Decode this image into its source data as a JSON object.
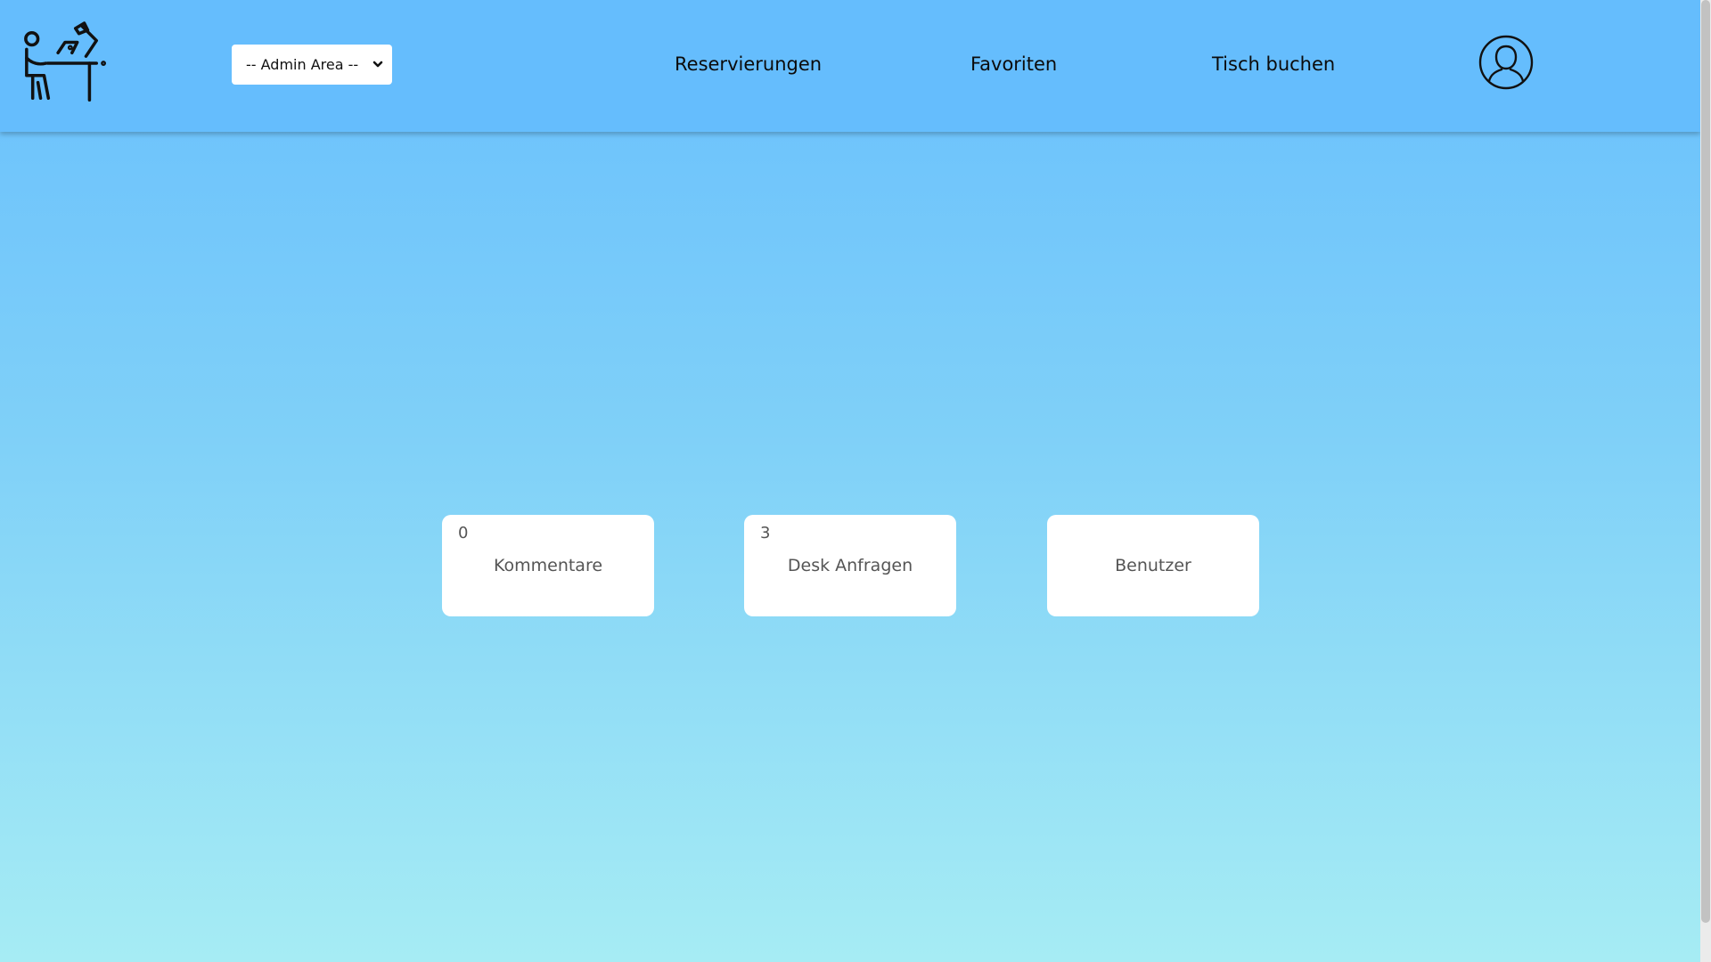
{
  "header": {
    "logo_icon": "desk-worker-icon",
    "admin_select": {
      "selected": "-- Admin Area --",
      "chevron_icon": "chevron-down-icon"
    },
    "nav": {
      "reservations": "Reservierungen",
      "favorites": "Favoriten",
      "book_desk": "Tisch buchen"
    },
    "profile_icon": "user-circle-icon"
  },
  "cards": [
    {
      "count": "0",
      "label": "Kommentare"
    },
    {
      "count": "3",
      "label": "Desk Anfragen"
    },
    {
      "count": "",
      "label": "Benutzer"
    }
  ],
  "colors": {
    "header_bg": "#65bdfd",
    "gradient_top": "#68bffd",
    "gradient_bottom": "#a6ecf4",
    "card_bg": "#ffffff",
    "card_text": "#555555"
  }
}
